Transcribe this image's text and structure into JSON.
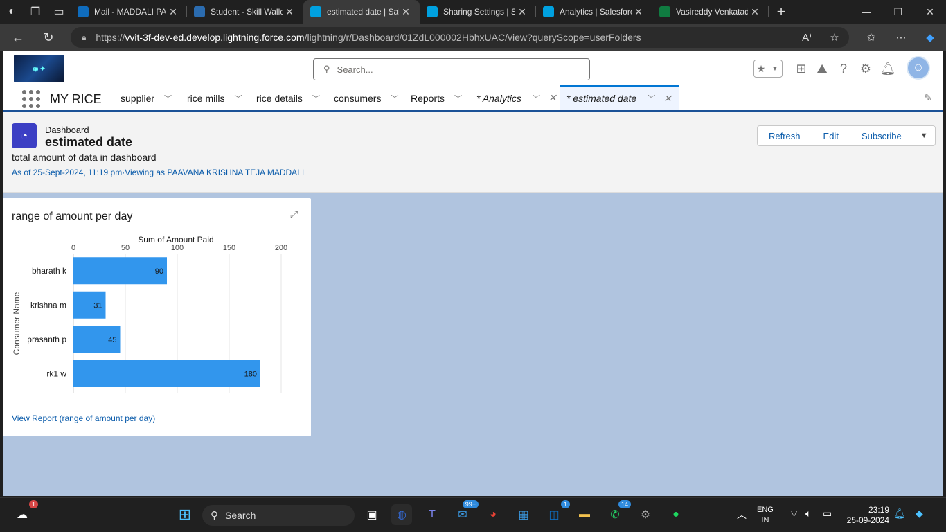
{
  "browser": {
    "tabs": [
      {
        "label": "Mail - MADDALI PAA",
        "fav_color": "#0f6cbd",
        "active": false
      },
      {
        "label": "Student - Skill Wallet",
        "fav_color": "#2b6cb0",
        "active": false
      },
      {
        "label": "estimated date | Sale",
        "fav_color": "#00a1e0",
        "active": true
      },
      {
        "label": "Sharing Settings | Sa",
        "fav_color": "#00a1e0",
        "active": false
      },
      {
        "label": "Analytics | Salesforce",
        "fav_color": "#00a1e0",
        "active": false
      },
      {
        "label": "Vasireddy Venkatadr",
        "fav_color": "#107c41",
        "active": false
      }
    ],
    "url_scheme": "https://",
    "url_host": "vvit-3f-dev-ed.develop.lightning.force.com",
    "url_path": "/lightning/r/Dashboard/01ZdL000002HbhxUAC/view?queryScope=userFolders"
  },
  "header": {
    "search_placeholder": "Search...",
    "app_name": "MY RICE",
    "nav": [
      {
        "label": "supplier"
      },
      {
        "label": "rice mills"
      },
      {
        "label": "rice details"
      },
      {
        "label": "consumers"
      },
      {
        "label": "Reports"
      },
      {
        "label": "* Analytics"
      },
      {
        "label": "* estimated date"
      }
    ]
  },
  "dashboard": {
    "type_label": "Dashboard",
    "title": "estimated date",
    "description": "total amount of data in dashboard",
    "meta": "As of 25-Sept-2024, 11:19 pm·Viewing as PAAVANA KRISHNA TEJA MADDALI",
    "buttons": {
      "refresh": "Refresh",
      "edit": "Edit",
      "subscribe": "Subscribe"
    }
  },
  "widget": {
    "title": "range of amount per day",
    "report_link": "View Report (range of amount per day)"
  },
  "chart_data": {
    "type": "bar",
    "orientation": "horizontal",
    "xlabel": "Sum of Amount Paid",
    "ylabel": "Consumer Name",
    "categories": [
      "bharath k",
      "krishna m",
      "prasanth p",
      "rk1 w"
    ],
    "values": [
      90,
      31,
      45,
      180
    ],
    "xlim": [
      0,
      200
    ],
    "xticks": [
      0,
      50,
      100,
      150,
      200
    ],
    "bar_color": "#3296ed",
    "grid": true
  },
  "taskbar": {
    "search_label": "Search",
    "badges": {
      "weather": "1",
      "mail": "99+",
      "store": "1",
      "whatsapp": "14"
    },
    "lang_line1": "ENG",
    "lang_line2": "IN",
    "time": "23:19",
    "date": "25-09-2024"
  }
}
